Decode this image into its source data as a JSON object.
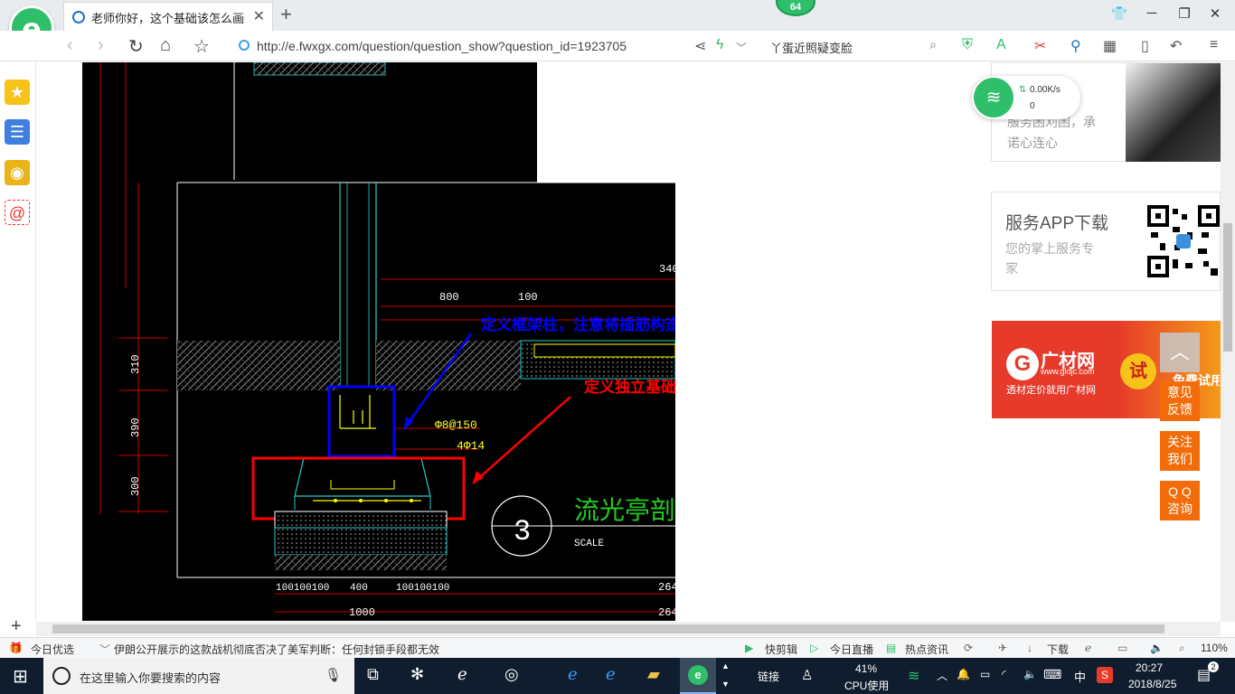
{
  "browser": {
    "tab_title": "老师你好，这个基础该怎么画呢",
    "tab_close": "✕",
    "new_tab": "+",
    "badge": "64",
    "url": "http://e.fwxgx.com/question/question_show?question_id=1923705",
    "search_text": "丫蛋近照疑变脸"
  },
  "cad": {
    "dims": {
      "d340": "340",
      "d800": "800",
      "d100": "100",
      "d310": "310",
      "d390": "390",
      "d300": "300",
      "d400": "400",
      "d1000": "1000",
      "d264a": "264",
      "d264b": "264",
      "dleft": "100100100",
      "dright": "100100100"
    },
    "rebar_stirrup": "Φ8@150",
    "rebar_main": "4Φ14",
    "annotation_blue": "定义框架柱，注意将插筋构造更改为“纵筋锚固”",
    "annotation_red": "定义独立基础",
    "section_number": "3",
    "section_title": "流光亭剖面",
    "scale_label": "SCALE"
  },
  "right": {
    "wifi_speed": "0.00K/s",
    "wifi_count": "0",
    "card1_text_a": "服务困刈困，承",
    "card1_text_b": "诺心连心",
    "app_title": "服务APP下载",
    "app_sub_a": "您的掌上服务专",
    "app_sub_b": "家",
    "ad_brand": "广材网",
    "ad_domain": "www.gldjc.com",
    "ad_slogan": "透材定价就用广材网",
    "ad_try": "试",
    "ad_free": "免费试用",
    "feedback_a": "意见",
    "feedback_b": "反馈",
    "follow_a": "关注",
    "follow_b": "我们",
    "qq_a": "Q Q",
    "qq_b": "咨询"
  },
  "statusbar": {
    "today_pick": "今日优选",
    "news": "伊朗公开展示的这款战机彻底否决了美军判断：任何封锁手段都无效",
    "quick_clip": "快剪辑",
    "live": "今日直播",
    "hot_news": "热点资讯",
    "download": "下载",
    "zoom": "110%"
  },
  "taskbar": {
    "search_placeholder": "在这里输入你要搜索的内容",
    "link": "链接",
    "cpu_pct": "41%",
    "cpu_label": "CPU使用",
    "ime": "中",
    "time": "20:27",
    "date": "2018/8/25",
    "notif_count": "2"
  },
  "colors": {
    "green_brand": "#2fbe6a",
    "orange_tool": "#f26d0a",
    "ad_red": "#e63b2a",
    "cad_bg": "#000000",
    "annot_blue": "#0000ff",
    "annot_red": "#ff0000",
    "taskbar": "#0f1d2e"
  }
}
